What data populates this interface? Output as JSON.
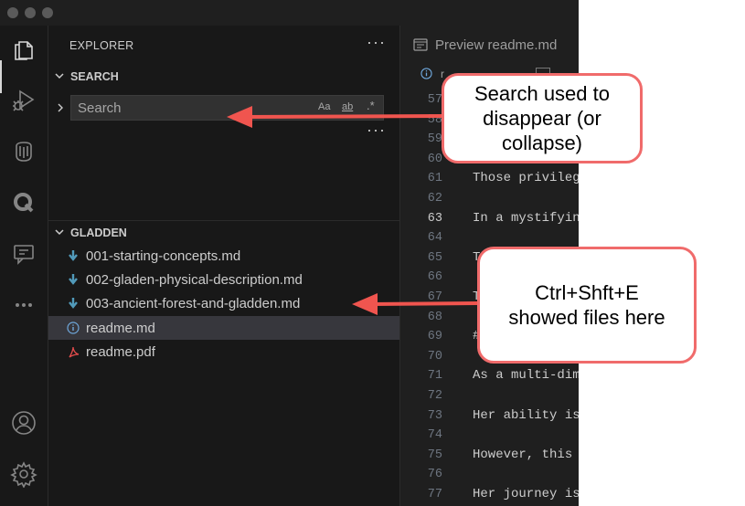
{
  "sidebar": {
    "title": "EXPLORER",
    "more": "···",
    "search_section": {
      "title": "SEARCH",
      "placeholder": "Search",
      "match_case": "Aa",
      "whole_word": "ab",
      "regex": ".*",
      "more": "···"
    },
    "folder": {
      "title": "GLADDEN",
      "files": [
        {
          "name": "001-starting-concepts.md",
          "icon": "markdown-download-icon"
        },
        {
          "name": "002-gladen-physical-description.md",
          "icon": "markdown-download-icon"
        },
        {
          "name": "003-ancient-forest-and-gladden.md",
          "icon": "markdown-download-icon"
        },
        {
          "name": "readme.md",
          "icon": "info-icon",
          "selected": true
        },
        {
          "name": "readme.pdf",
          "icon": "pdf-icon"
        }
      ]
    }
  },
  "editor": {
    "tab_label": "Preview readme.md",
    "breadcrumb": "r",
    "lines": [
      {
        "n": "57",
        "text": ""
      },
      {
        "n": "58",
        "text": ""
      },
      {
        "n": "59",
        "text": ""
      },
      {
        "n": "60",
        "text": ""
      },
      {
        "n": "61",
        "text": "Those privileg"
      },
      {
        "n": "62",
        "text": ""
      },
      {
        "n": "63",
        "text": "In a mystifyin"
      },
      {
        "n": "64",
        "text": ""
      },
      {
        "n": "65",
        "text": "T"
      },
      {
        "n": "66",
        "text": ""
      },
      {
        "n": "67",
        "text": "T"
      },
      {
        "n": "68",
        "text": ""
      },
      {
        "n": "69",
        "text": "#"
      },
      {
        "n": "70",
        "text": ""
      },
      {
        "n": "71",
        "text": "As a multi-dim"
      },
      {
        "n": "72",
        "text": ""
      },
      {
        "n": "73",
        "text": "Her ability is"
      },
      {
        "n": "74",
        "text": ""
      },
      {
        "n": "75",
        "text": "However, this"
      },
      {
        "n": "76",
        "text": ""
      },
      {
        "n": "77",
        "text": "Her journey is"
      }
    ],
    "current_line": "63"
  },
  "annotations": {
    "callout_search": [
      "Search used to",
      "disappear (or",
      "collapse)"
    ],
    "callout_files": [
      "Ctrl+Shft+E",
      "showed files here"
    ],
    "arrow_color": "#f0554f"
  },
  "activity_bar": [
    "explorer-icon",
    "run-debug-icon",
    "database-icon",
    "q-icon",
    "remote-chat-icon",
    "more-icon",
    "account-icon",
    "settings-gear-icon"
  ]
}
